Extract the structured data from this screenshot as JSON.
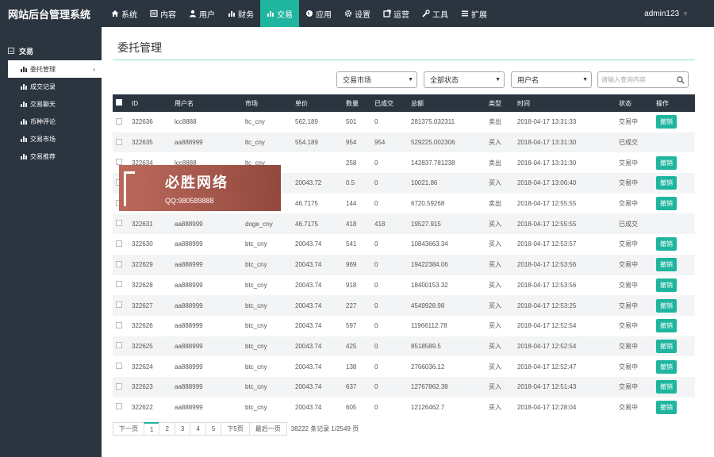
{
  "brand": "网站后台管理系统",
  "nav": [
    {
      "label": "系统",
      "icon": "home-icon"
    },
    {
      "label": "内容",
      "icon": "document-icon"
    },
    {
      "label": "用户",
      "icon": "user-icon"
    },
    {
      "label": "财务",
      "icon": "money-icon"
    },
    {
      "label": "交易",
      "icon": "bar-chart-icon",
      "active": true
    },
    {
      "label": "应用",
      "icon": "globe-icon"
    },
    {
      "label": "设置",
      "icon": "gear-icon"
    },
    {
      "label": "运营",
      "icon": "external-link-icon"
    },
    {
      "label": "工具",
      "icon": "wrench-icon"
    },
    {
      "label": "扩展",
      "icon": "list-icon"
    }
  ],
  "user": {
    "name": "admin123"
  },
  "sidebar": {
    "section": "交易",
    "items": [
      {
        "label": "委托管理",
        "active": true
      },
      {
        "label": "成交记录"
      },
      {
        "label": "交易聊天"
      },
      {
        "label": "币种评论"
      },
      {
        "label": "交易市场"
      },
      {
        "label": "交易推荐"
      }
    ]
  },
  "page": {
    "title": "委托管理"
  },
  "filters": {
    "market": "交易市场",
    "status": "全部状态",
    "field": "用户名",
    "search_placeholder": "请输入查询内容"
  },
  "table": {
    "headers": [
      "ID",
      "用户名",
      "市场",
      "单价",
      "数量",
      "已成交",
      "总额",
      "类型",
      "时间",
      "状态",
      "操作"
    ],
    "cancel_label": "撤销",
    "rows": [
      {
        "id": "322636",
        "user": "lcc8888",
        "market": "ltc_cny",
        "price": "562.189",
        "qty": "501",
        "filled": "0",
        "total": "281375.032311",
        "type": "卖出",
        "time": "2018-04-17 13:31:33",
        "status": "交易中",
        "action": true
      },
      {
        "id": "322635",
        "user": "aa888999",
        "market": "ltc_cny",
        "price": "554.189",
        "qty": "954",
        "filled": "954",
        "total": "529225.002306",
        "type": "买入",
        "time": "2018-04-17 13:31:30",
        "status": "已成交",
        "action": false
      },
      {
        "id": "322634",
        "user": "lcc8888",
        "market": "ltc_cny",
        "price": "",
        "qty": "258",
        "filled": "0",
        "total": "142837.781238",
        "type": "卖出",
        "time": "2018-04-17 13:31:30",
        "status": "交易中",
        "action": true
      },
      {
        "id": "",
        "user": "",
        "market": "",
        "price": "20043.72",
        "qty": "0.5",
        "filled": "0",
        "total": "10021.86",
        "type": "买入",
        "time": "2018-04-17 13:06:40",
        "status": "交易中",
        "action": true
      },
      {
        "id": "",
        "user": "",
        "market": "",
        "price": "46.7175",
        "qty": "144",
        "filled": "0",
        "total": "6720.59268",
        "type": "卖出",
        "time": "2018-04-17 12:55:55",
        "status": "交易中",
        "action": true
      },
      {
        "id": "322631",
        "user": "aa888999",
        "market": "doge_cny",
        "price": "46.7175",
        "qty": "418",
        "filled": "418",
        "total": "19527.915",
        "type": "买入",
        "time": "2018-04-17 12:55:55",
        "status": "已成交",
        "action": false
      },
      {
        "id": "322630",
        "user": "aa888999",
        "market": "btc_cny",
        "price": "20043.74",
        "qty": "541",
        "filled": "0",
        "total": "10843663.34",
        "type": "买入",
        "time": "2018-04-17 12:53:57",
        "status": "交易中",
        "action": true
      },
      {
        "id": "322629",
        "user": "aa888999",
        "market": "btc_cny",
        "price": "20043.74",
        "qty": "969",
        "filled": "0",
        "total": "19422384.06",
        "type": "买入",
        "time": "2018-04-17 12:53:56",
        "status": "交易中",
        "action": true
      },
      {
        "id": "322628",
        "user": "aa888999",
        "market": "btc_cny",
        "price": "20043.74",
        "qty": "918",
        "filled": "0",
        "total": "18400153.32",
        "type": "买入",
        "time": "2018-04-17 12:53:56",
        "status": "交易中",
        "action": true
      },
      {
        "id": "322627",
        "user": "aa888999",
        "market": "btc_cny",
        "price": "20043.74",
        "qty": "227",
        "filled": "0",
        "total": "4549928.98",
        "type": "买入",
        "time": "2018-04-17 12:53:25",
        "status": "交易中",
        "action": true
      },
      {
        "id": "322626",
        "user": "aa888999",
        "market": "btc_cny",
        "price": "20043.74",
        "qty": "597",
        "filled": "0",
        "total": "11966112.78",
        "type": "买入",
        "time": "2018-04-17 12:52:54",
        "status": "交易中",
        "action": true
      },
      {
        "id": "322625",
        "user": "aa888999",
        "market": "btc_cny",
        "price": "20043.74",
        "qty": "425",
        "filled": "0",
        "total": "8518589.5",
        "type": "买入",
        "time": "2018-04-17 12:52:54",
        "status": "交易中",
        "action": true
      },
      {
        "id": "322624",
        "user": "aa888999",
        "market": "btc_cny",
        "price": "20043.74",
        "qty": "138",
        "filled": "0",
        "total": "2766036.12",
        "type": "买入",
        "time": "2018-04-17 12:52:47",
        "status": "交易中",
        "action": true
      },
      {
        "id": "322623",
        "user": "aa888999",
        "market": "btc_cny",
        "price": "20043.74",
        "qty": "637",
        "filled": "0",
        "total": "12767862.38",
        "type": "买入",
        "time": "2018-04-17 12:51:43",
        "status": "交易中",
        "action": true
      },
      {
        "id": "322622",
        "user": "aa888999",
        "market": "btc_cny",
        "price": "20043.74",
        "qty": "605",
        "filled": "0",
        "total": "12126462.7",
        "type": "买入",
        "time": "2018-04-17 12:28:04",
        "status": "交易中",
        "action": true
      }
    ]
  },
  "pagination": {
    "pages": [
      "下一页",
      "1",
      "2",
      "3",
      "4",
      "5",
      "下5页",
      "最后一页"
    ],
    "current": "1",
    "info": "38222 条记录 1/2549 页"
  },
  "watermark": {
    "title": "必胜网络",
    "sub": "QQ:980589888"
  },
  "colors": {
    "accent": "#1fb59e",
    "nav_bg": "#2b3540"
  }
}
